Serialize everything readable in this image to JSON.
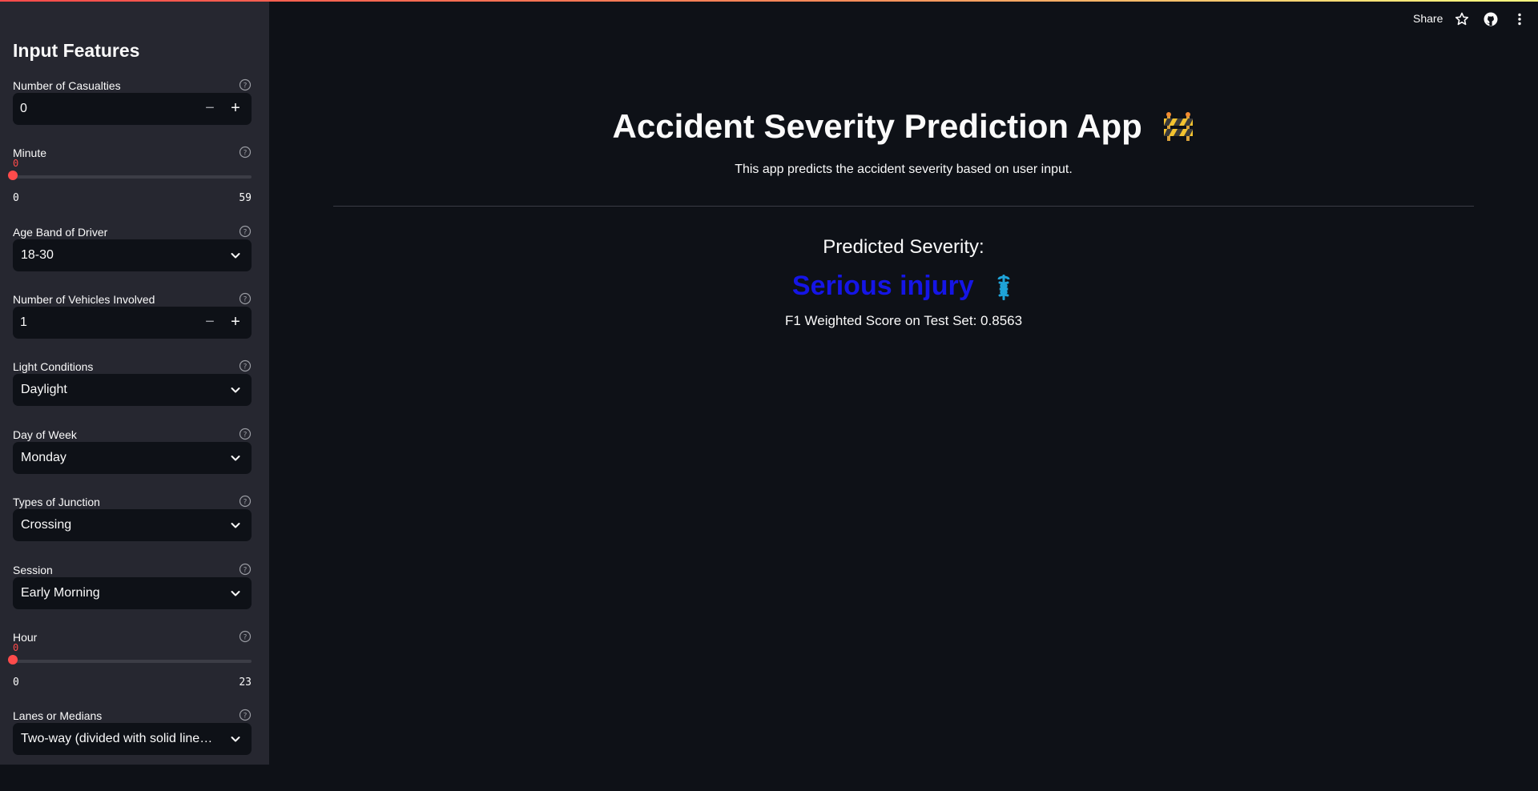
{
  "sidebar": {
    "title": "Input Features",
    "fields": [
      {
        "label": "Number of Casualties",
        "type": "number",
        "value": "0"
      },
      {
        "label": "Minute",
        "type": "slider",
        "value": "0",
        "min": "0",
        "max": "59"
      },
      {
        "label": "Age Band of Driver",
        "type": "select",
        "value": "18-30"
      },
      {
        "label": "Number of Vehicles Involved",
        "type": "number",
        "value": "1"
      },
      {
        "label": "Light Conditions",
        "type": "select",
        "value": "Daylight"
      },
      {
        "label": "Day of Week",
        "type": "select",
        "value": "Monday"
      },
      {
        "label": "Types of Junction",
        "type": "select",
        "value": "Crossing"
      },
      {
        "label": "Session",
        "type": "select",
        "value": "Early Morning"
      },
      {
        "label": "Hour",
        "type": "slider",
        "value": "0",
        "min": "0",
        "max": "23"
      },
      {
        "label": "Lanes or Medians",
        "type": "select",
        "value": "Two-way (divided with solid lines …"
      }
    ],
    "stepper": {
      "minus": "−",
      "plus": "+"
    }
  },
  "toolbar": {
    "share_label": "Share"
  },
  "main": {
    "title": "Accident Severity Prediction App",
    "subtitle": "This app predicts the accident severity based on user input.",
    "prediction_heading": "Predicted Severity:",
    "prediction_value": "Serious injury",
    "score_text": "F1 Weighted Score on Test Set: 0.8563"
  },
  "colors": {
    "background": "#0e1117",
    "sidebar": "#262730",
    "accent": "#ff4b4b",
    "prediction": "#1515e6"
  }
}
